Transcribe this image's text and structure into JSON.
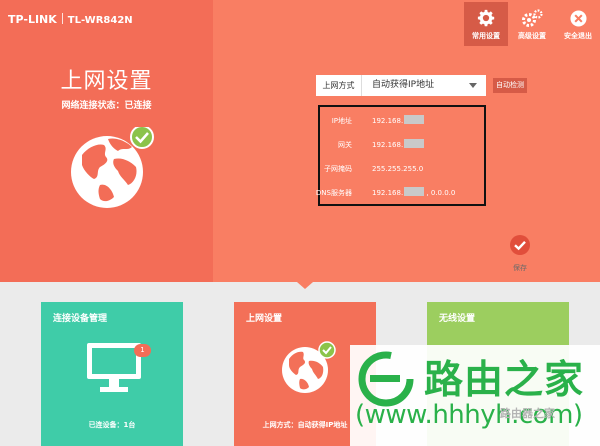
{
  "header": {
    "brand": "TP-LINK",
    "model": "TL-WR842N"
  },
  "nav": {
    "common_settings": "常用设置",
    "advanced_settings": "高级设置",
    "logout": "安全退出"
  },
  "page": {
    "title": "上网设置",
    "status_label": "网络连接状态：",
    "status_value": "已连接"
  },
  "form": {
    "method_label": "上网方式",
    "method_value": "自动获得IP地址",
    "auto_detect": "自动检测"
  },
  "info": {
    "ip_label": "IP地址",
    "ip_value": "192.168.",
    "gateway_label": "网关",
    "gateway_value": "192.168.",
    "subnet_label": "子网掩码",
    "subnet_value": "255.255.255.0",
    "dns_label": "DNS服务器",
    "dns_value": "192.168.",
    "dns_value2": ", 0.0.0.0"
  },
  "save": {
    "label": "保存"
  },
  "cards": {
    "devices": {
      "title": "连接设备管理",
      "count": "1",
      "footer": "已连设备：1台"
    },
    "network": {
      "title": "上网设置",
      "footer": "上网方式：自动获得IP地址"
    },
    "wireless": {
      "title": "无线设置"
    }
  },
  "watermark": {
    "text": "路由之家",
    "url": "(www.hhhyh.com)",
    "small": "路由器之家"
  },
  "colors": {
    "top_bg": "#f97e63",
    "left_panel": "#f36d57",
    "card_devices": "#3fcca8",
    "card_network": "#f37058",
    "card_wireless": "#9cce5f",
    "check_green": "#8bc34a",
    "watermark_green": "#2ab14a"
  }
}
